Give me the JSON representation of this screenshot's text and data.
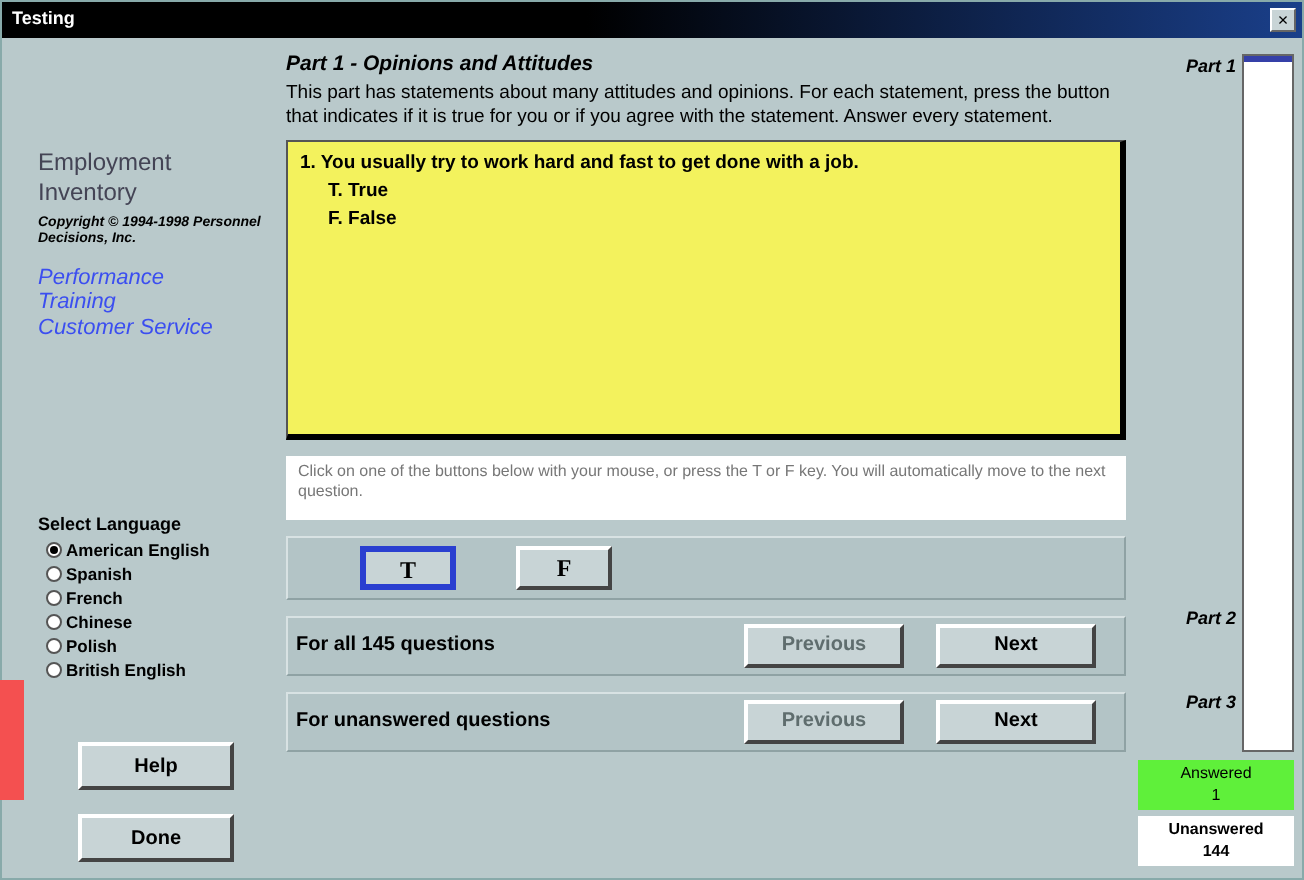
{
  "window": {
    "title": "Testing",
    "close": "×"
  },
  "sidebar": {
    "title": "Employment Inventory",
    "copyright": "Copyright © 1994-1998 Personnel Decisions, Inc.",
    "links": [
      "Performance",
      "Training",
      "Customer Service"
    ],
    "language_label": "Select Language",
    "languages": [
      {
        "label": "American English",
        "selected": true
      },
      {
        "label": "Spanish",
        "selected": false
      },
      {
        "label": "French",
        "selected": false
      },
      {
        "label": "Chinese",
        "selected": false
      },
      {
        "label": "Polish",
        "selected": false
      },
      {
        "label": "British English",
        "selected": false
      }
    ],
    "buttons": [
      "Help",
      "Done"
    ]
  },
  "part": {
    "title": "Part 1 - Opinions and Attitudes",
    "description": "This part has statements about many attitudes and opinions. For each statement, press the button that indicates if it is true for you or if you agree with the statement. Answer every statement."
  },
  "question": {
    "text": "1.  You usually try to work hard and fast to get done with a job.",
    "options": [
      "T.  True",
      "F.  False"
    ]
  },
  "instructions": "Click on one of the buttons below with your mouse, or press the T or F key. You will automatically move to the next question.",
  "answer_buttons": [
    {
      "label": "T",
      "selected": true
    },
    {
      "label": "F",
      "selected": false
    }
  ],
  "navigation": [
    {
      "label": "For all 145 questions",
      "previous": "Previous",
      "previous_disabled": true,
      "next": "Next"
    },
    {
      "label": "For unanswered questions",
      "previous": "Previous",
      "previous_disabled": true,
      "next": "Next"
    }
  ],
  "progress": {
    "parts": [
      "Part 1",
      "Part 2",
      "Part 3"
    ],
    "level": 0.01,
    "answered": [
      "Answered",
      "1"
    ],
    "unanswered": [
      "Unanswered",
      "144"
    ]
  }
}
